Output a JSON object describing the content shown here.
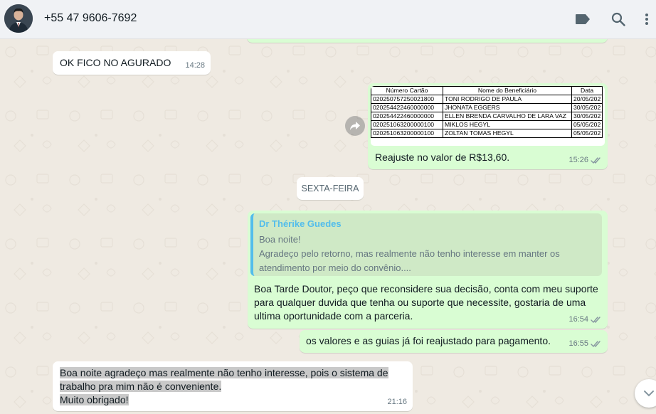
{
  "header": {
    "contact_name": "+55 47 9606-7692"
  },
  "messages": {
    "m1": {
      "text": "OK FICO NO AGURADO",
      "time": "14:28"
    },
    "m2": {
      "table": {
        "headers": [
          "Número Cartão",
          "Nome do Beneficiário",
          "Data"
        ],
        "rows": [
          [
            "020250757250021800",
            "TONI RODRIGO DE PAULA",
            "20/05/202"
          ],
          [
            "020254422460000000",
            "JHONATA EGGERS",
            "30/05/202"
          ],
          [
            "020254422460000000",
            "ELLEN BRENDA CARVALHO DE LARA VAZ",
            "30/05/202"
          ],
          [
            "020251063200000100",
            "MIKLOS HEGYL",
            "05/05/202"
          ],
          [
            "020251063200000100",
            "ZOLTAN TOMAS HEGYL",
            "05/05/202"
          ]
        ]
      },
      "caption": "Reajuste no valor de R$13,60.",
      "time": "15:26"
    },
    "date_divider": "SEXTA-FEIRA",
    "m3": {
      "quote_author": "Dr Thérike Guedes",
      "quote_line1": "Boa noite!",
      "quote_line2": "Agradeço pelo retorno, mas realmente não tenho interesse em manter os",
      "quote_line3": "atendimento por meio do convênio....",
      "line1": "Boa Tarde Doutor, peço que reconsidere sua decisão, conta com meu suporte",
      "line2": "para qualquer duvida que tenha ou suporte que necessite, gostaria de uma",
      "line3": "ultima oportunidade com a  parceria.",
      "time": "16:54"
    },
    "m4": {
      "text": "os valores e as guias já foi reajustado para pagamento.",
      "time": "16:55"
    },
    "m5": {
      "line1": "Boa noite agradeço mas realmente não tenho interesse, pois o sistema de",
      "line2": "trabalho pra mim não é conveniente.",
      "line3": "Muito obrigado!",
      "time": "21:16"
    }
  },
  "colors": {
    "incoming": "#ffffff",
    "outgoing": "#d9fdd3",
    "quote_accent": "#53bdeb",
    "read_ticks": "#8696a0",
    "background": "#efeae2"
  },
  "icons": [
    "label-icon",
    "search-icon",
    "menu-dots-icon",
    "forward-icon",
    "double-check-icon",
    "chevron-down-icon"
  ]
}
